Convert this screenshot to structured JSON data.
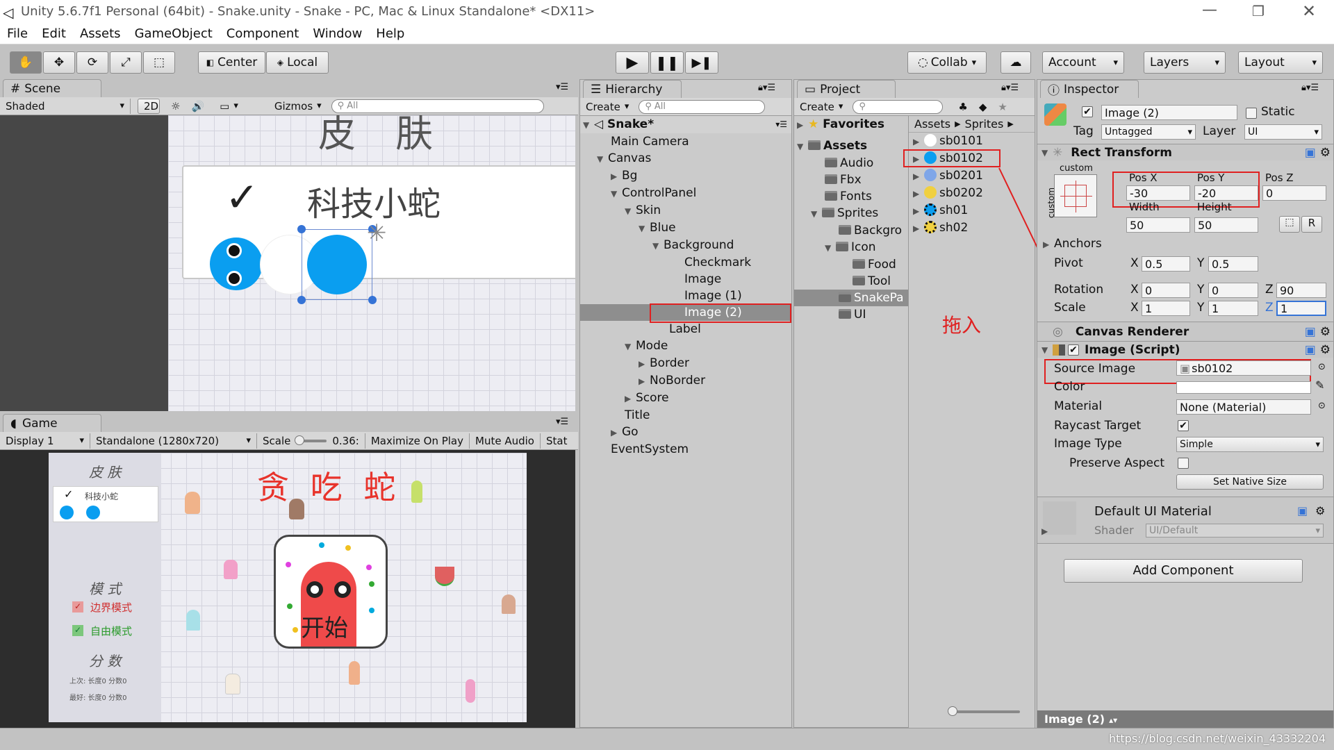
{
  "window": {
    "title": "Unity 5.6.7f1 Personal (64bit) - Snake.unity - Snake - PC, Mac & Linux Standalone* <DX11>"
  },
  "menu": [
    "File",
    "Edit",
    "Assets",
    "GameObject",
    "Component",
    "Window",
    "Help"
  ],
  "toolbar": {
    "center": "Center",
    "local": "Local",
    "collab": "Collab",
    "account": "Account",
    "layers": "Layers",
    "layout": "Layout"
  },
  "scene": {
    "tab": "Scene",
    "shading": "Shaded",
    "mode2d": "2D",
    "gizmos": "Gizmos",
    "search": "All",
    "header_text": "皮 肤",
    "skin_label": "科技小蛇",
    "check": "✓"
  },
  "game": {
    "tab": "Game",
    "display": "Display 1",
    "resolution": "Standalone (1280x720)",
    "scale_label": "Scale",
    "scale_value": "0.36:",
    "maximize": "Maximize On Play",
    "mute": "Mute Audio",
    "stats": "Stat",
    "title": "贪 吃 蛇",
    "skin_title": "皮 肤",
    "skin_item": "科技小蛇",
    "mode_title": "模 式",
    "border_mode": "边界模式",
    "free_mode": "自由模式",
    "score_title": "分 数",
    "score_row1": "上次: 长度0 分数0",
    "score_row2": "最好: 长度0 分数0",
    "start": "开始"
  },
  "hierarchy": {
    "tab": "Hierarchy",
    "create": "Create",
    "search": "All",
    "root": "Snake*",
    "items": [
      "Main Camera",
      "Canvas",
      "Bg",
      "ControlPanel",
      "Skin",
      "Blue",
      "Background",
      "Checkmark",
      "Image",
      "Image (1)",
      "Image (2)",
      "Label",
      "Mode",
      "Border",
      "NoBorder",
      "Score",
      "Title",
      "Go",
      "EventSystem"
    ]
  },
  "project": {
    "tab": "Project",
    "create": "Create",
    "favorites": "Favorites",
    "assets": "Assets",
    "folders": [
      "Audio",
      "Fbx",
      "Fonts",
      "Sprites",
      "Backgro",
      "Icon",
      "Food",
      "Tool",
      "SnakePa",
      "UI"
    ],
    "breadcrumb": [
      "Assets",
      "Sprites"
    ],
    "files": [
      "sb0101",
      "sb0102",
      "sb0201",
      "sb0202",
      "sh01",
      "sh02"
    ],
    "annotation": "拖入"
  },
  "inspector": {
    "tab": "Inspector",
    "object_name": "Image (2)",
    "static": "Static",
    "tag_label": "Tag",
    "tag": "Untagged",
    "layer_label": "Layer",
    "layer": "UI",
    "rect": {
      "title": "Rect Transform",
      "custom": "custom",
      "posx_label": "Pos X",
      "posy_label": "Pos Y",
      "posz_label": "Pos Z",
      "posx": "-30",
      "posy": "-20",
      "posz": "0",
      "width_label": "Width",
      "height_label": "Height",
      "width": "50",
      "height": "50",
      "anchors": "Anchors",
      "pivot": "Pivot",
      "pivot_x": "0.5",
      "pivot_y": "0.5",
      "rotation": "Rotation",
      "rot_x": "0",
      "rot_y": "0",
      "rot_z": "90",
      "scale": "Scale",
      "scale_x": "1",
      "scale_y": "1",
      "scale_z": "1",
      "r": "R"
    },
    "canvas_renderer": "Canvas Renderer",
    "image_script": "Image (Script)",
    "source_image_label": "Source Image",
    "source_image": "sb0102",
    "color_label": "Color",
    "material_label": "Material",
    "material": "None (Material)",
    "raycast_label": "Raycast Target",
    "image_type_label": "Image Type",
    "image_type": "Simple",
    "preserve_label": "Preserve Aspect",
    "native_size": "Set Native Size",
    "default_mat": "Default UI Material",
    "shader_label": "Shader",
    "shader": "UI/Default",
    "add_component": "Add Component",
    "footer": "Image (2)"
  },
  "status": {
    "watermark": "https://blog.csdn.net/weixin_43332204"
  },
  "colors": {
    "accent_blue": "#0a9ef0",
    "red_box": "#e02020",
    "title_red": "#e8332b",
    "selection": "#8e8e8e"
  }
}
